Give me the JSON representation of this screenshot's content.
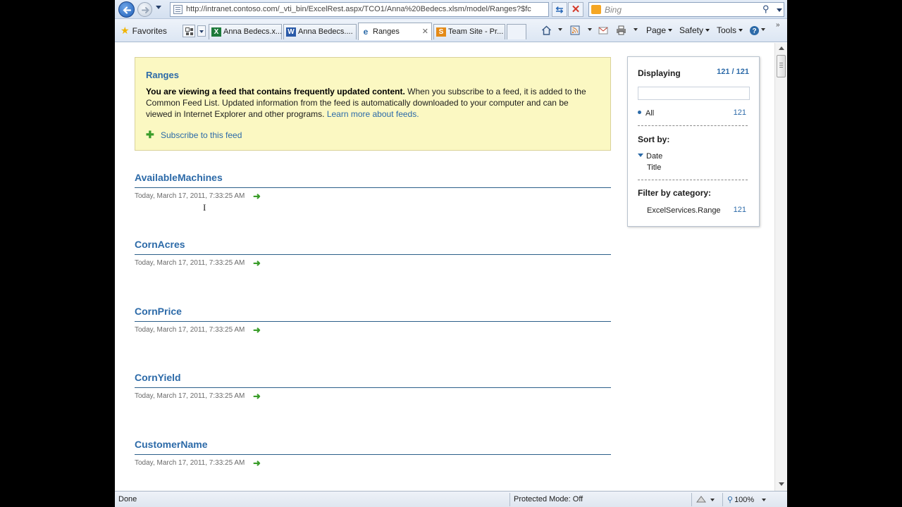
{
  "browser": {
    "address": "http://intranet.contoso.com/_vti_bin/ExcelRest.aspx/TCO1/Anna%20Bedecs.xlsm/model/Ranges?$fc",
    "search_placeholder": "Bing",
    "favorites_label": "Favorites",
    "tabs": [
      {
        "label": "Anna Bedecs.x...",
        "icon": "excel-icon",
        "color": "#1d7a3a"
      },
      {
        "label": "Anna Bedecs....",
        "icon": "word-icon",
        "color": "#2a5aa8"
      },
      {
        "label": "Ranges",
        "icon": "feed-icon",
        "color": "#2c6aa8"
      },
      {
        "label": "Team Site - Pr...",
        "icon": "sharepoint-icon",
        "color": "#e48a18"
      }
    ],
    "commands": {
      "page": "Page",
      "safety": "Safety",
      "tools": "Tools"
    }
  },
  "banner": {
    "title": "Ranges",
    "bold_text": "You are viewing a feed that contains frequently updated content.",
    "text": " When you subscribe to a feed, it is added to the Common Feed List. Updated information from the feed is automatically downloaded to your computer and can be viewed in Internet Explorer and other programs. ",
    "link": "Learn more about feeds.",
    "subscribe": "Subscribe to this feed"
  },
  "entries": [
    {
      "title": "AvailableMachines",
      "date": "Today, March 17, 2011, 7:33:25 AM"
    },
    {
      "title": "CornAcres",
      "date": "Today, March 17, 2011, 7:33:25 AM"
    },
    {
      "title": "CornPrice",
      "date": "Today, March 17, 2011, 7:33:25 AM"
    },
    {
      "title": "CornYield",
      "date": "Today, March 17, 2011, 7:33:25 AM"
    },
    {
      "title": "CustomerName",
      "date": "Today, March 17, 2011, 7:33:25 AM"
    }
  ],
  "sidebar": {
    "displaying_label": "Displaying",
    "displaying_count": "121 / 121",
    "all_label": "All",
    "all_count": "121",
    "sort_by_label": "Sort by:",
    "sort_date": "Date",
    "sort_title": "Title",
    "filter_label": "Filter by category:",
    "category": "ExcelServices.Range",
    "category_count": "121"
  },
  "status": {
    "text": "Done",
    "protected_mode": "Protected Mode: Off",
    "zoom": "100%"
  },
  "colors": {
    "link": "#2c6aa8",
    "banner_bg": "#fbf8c2",
    "accent_green": "#3a9d2a"
  }
}
